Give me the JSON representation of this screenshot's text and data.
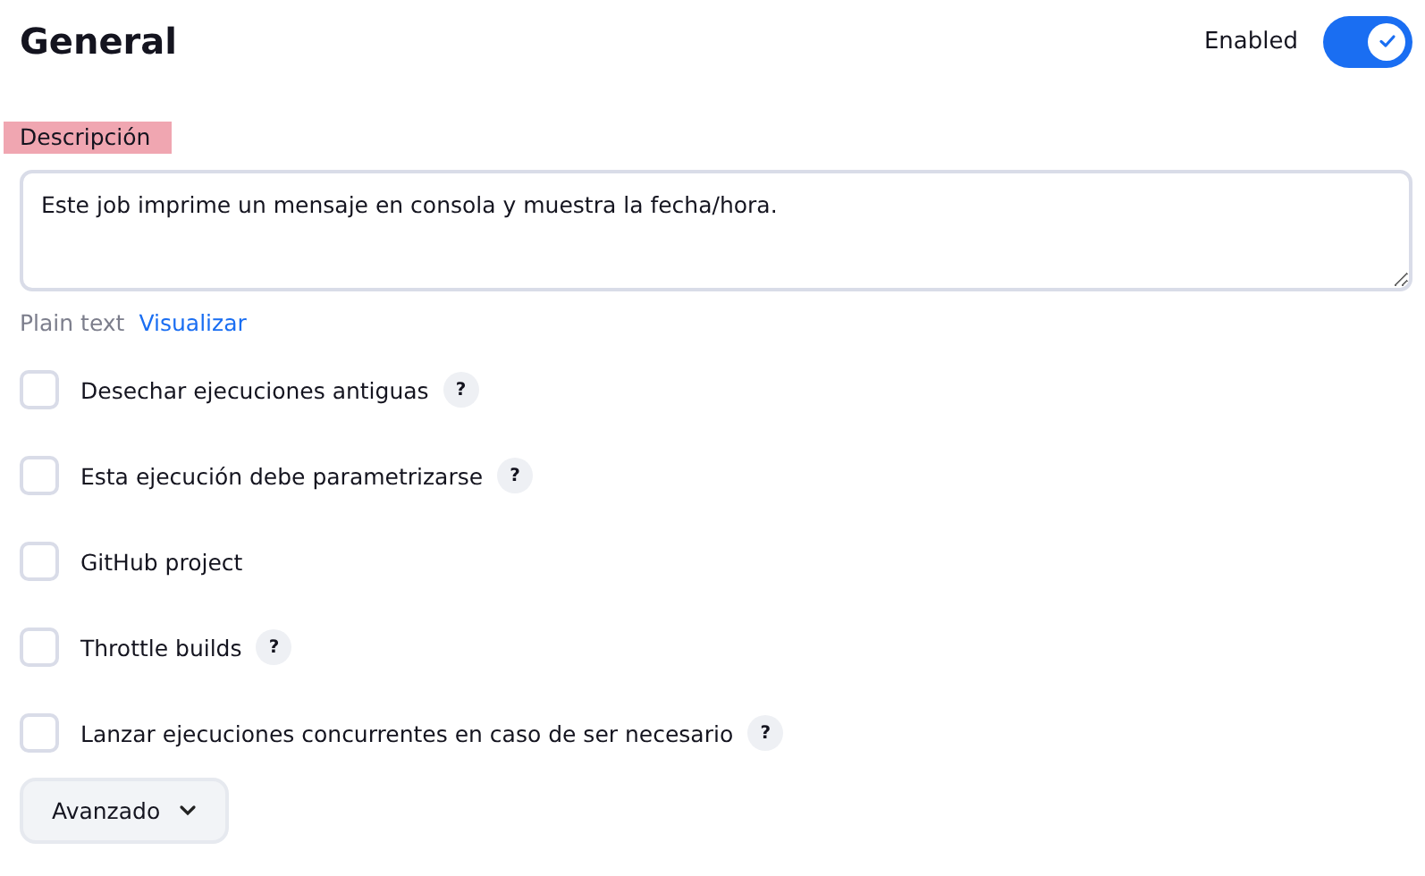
{
  "section": {
    "title": "General",
    "enabled_label": "Enabled",
    "enabled": true
  },
  "description": {
    "label": "Descripción",
    "highlighted": true,
    "value": "Este job imprime un mensaje en consola y muestra la fecha/hora.",
    "modes": [
      {
        "label": "Plain text",
        "selected": true
      },
      {
        "label": "Visualizar",
        "selected": false
      }
    ]
  },
  "options": [
    {
      "label": "Desechar ejecuciones antiguas",
      "checked": false,
      "help": "?"
    },
    {
      "label": "Esta ejecución debe parametrizarse",
      "checked": false,
      "help": "?"
    },
    {
      "label": "GitHub project",
      "checked": false
    },
    {
      "label": "Throttle builds",
      "checked": false,
      "help": "?"
    },
    {
      "label": "Lanzar ejecuciones concurrentes en caso de ser necesario",
      "checked": false,
      "help": "?"
    }
  ],
  "advanced_button": "Avanzado"
}
